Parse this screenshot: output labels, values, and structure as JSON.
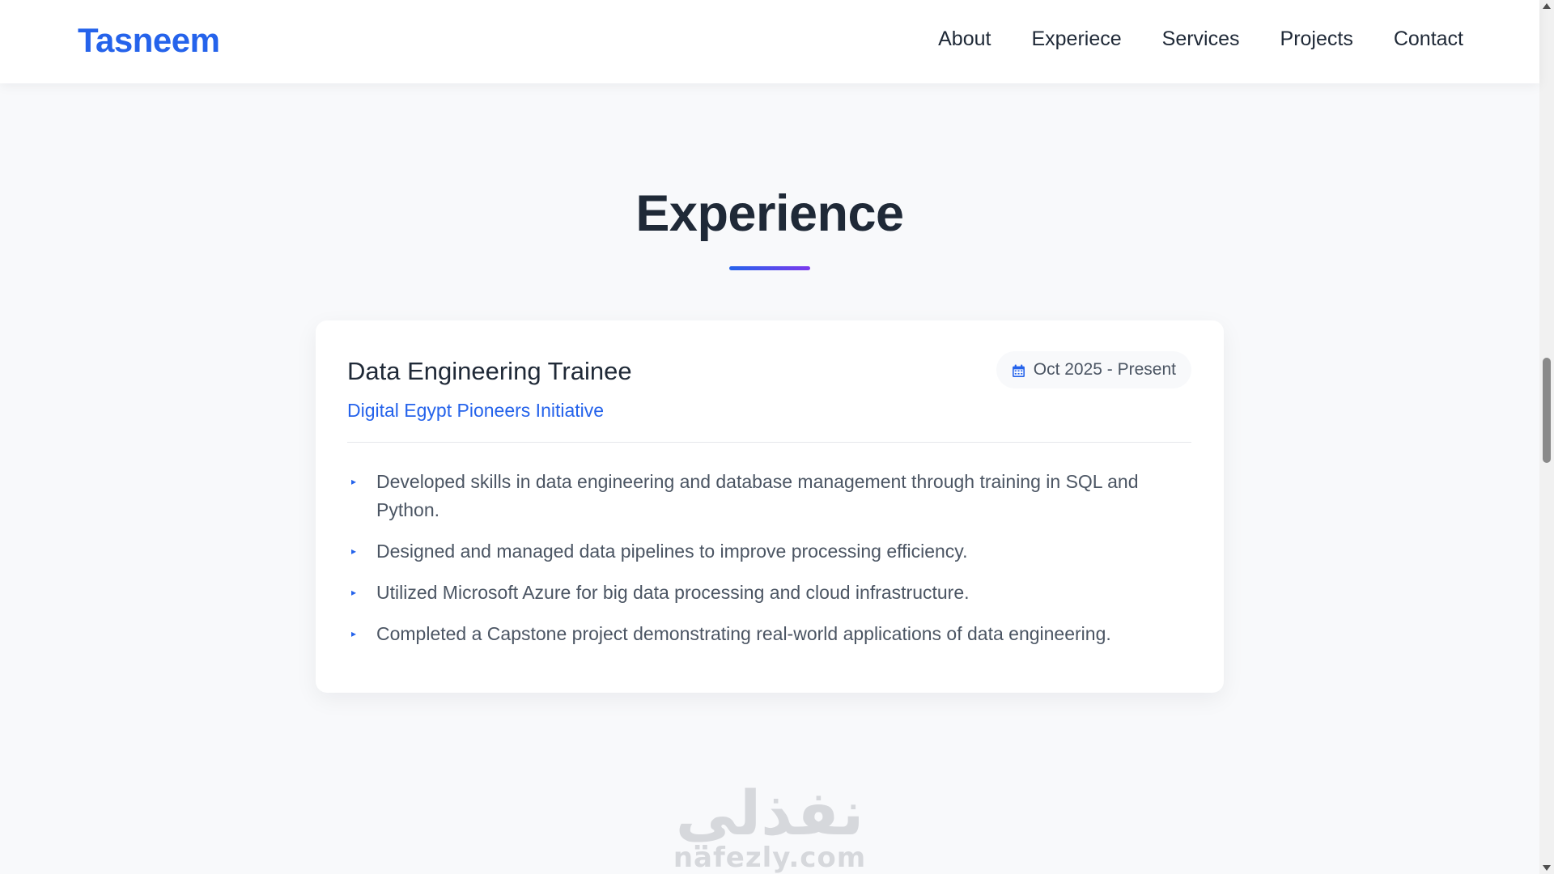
{
  "navbar": {
    "brand": "Tasneem",
    "links": [
      "About",
      "Experiece",
      "Services",
      "Projects",
      "Contact"
    ]
  },
  "experience": {
    "title": "Experience",
    "card": {
      "job_title": "Data Engineering Trainee",
      "company": "Digital Egypt Pioneers Initiative",
      "date": "Oct 2025 - Present",
      "bullets": [
        "Developed skills in data engineering and database management through training in SQL and Python.",
        "Designed and managed data pipelines to improve processing efficiency.",
        "Utilized Microsoft Azure for big data processing and cloud infrastructure.",
        "Completed a Capstone project demonstrating real-world applications of data engineering."
      ],
      "bullet_marker": "▸",
      "calendar_icon": "calendar-icon"
    }
  },
  "watermark": {
    "arabic": "نفذلي",
    "latin": "nafezly.com"
  },
  "colors": {
    "accent": "#2563eb",
    "accent_secondary": "#7c3aed",
    "text_dark": "#1f2937",
    "text_muted": "#4b5563"
  }
}
